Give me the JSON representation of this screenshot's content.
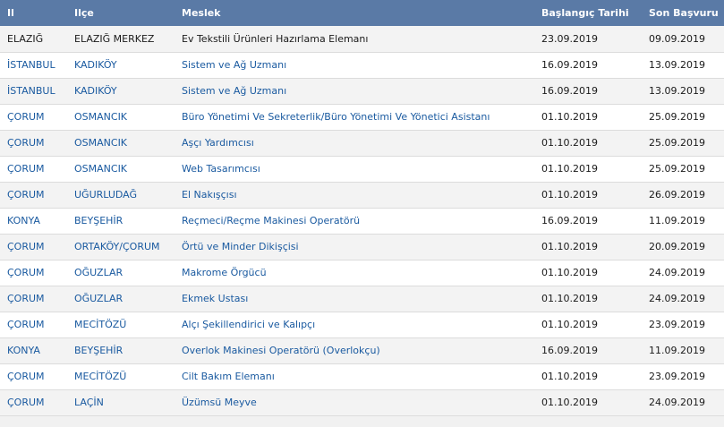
{
  "headers": {
    "il": "Il",
    "ilce": "Ilçe",
    "meslek": "Meslek",
    "baslangic": "Başlangıç Tarihi",
    "son": "Son Başvuru"
  },
  "rows": [
    {
      "il": "ELAZIĞ",
      "ilce": "ELAZIĞ MERKEZ",
      "meslek": "Ev Tekstili Ürünleri Hazırlama Elemanı",
      "baslangic": "23.09.2019",
      "son": "09.09.2019"
    },
    {
      "il": "İSTANBUL",
      "ilce": "KADIKÖY",
      "meslek": "Sistem ve Ağ Uzmanı",
      "baslangic": "16.09.2019",
      "son": "13.09.2019"
    },
    {
      "il": "İSTANBUL",
      "ilce": "KADIKÖY",
      "meslek": "Sistem ve Ağ Uzmanı",
      "baslangic": "16.09.2019",
      "son": "13.09.2019"
    },
    {
      "il": "ÇORUM",
      "ilce": "OSMANCIK",
      "meslek": "Büro Yönetimi Ve Sekreterlik/Büro Yönetimi Ve Yönetici Asistanı",
      "baslangic": "01.10.2019",
      "son": "25.09.2019"
    },
    {
      "il": "ÇORUM",
      "ilce": "OSMANCIK",
      "meslek": "Aşçı Yardımcısı",
      "baslangic": "01.10.2019",
      "son": "25.09.2019"
    },
    {
      "il": "ÇORUM",
      "ilce": "OSMANCIK",
      "meslek": "Web Tasarımcısı",
      "baslangic": "01.10.2019",
      "son": "25.09.2019"
    },
    {
      "il": "ÇORUM",
      "ilce": "UĞURLUDAĞ",
      "meslek": "El Nakışçısı",
      "baslangic": "01.10.2019",
      "son": "26.09.2019"
    },
    {
      "il": "KONYA",
      "ilce": "BEYŞEHİR",
      "meslek": "Reçmeci/Reçme Makinesi Operatörü",
      "baslangic": "16.09.2019",
      "son": "11.09.2019"
    },
    {
      "il": "ÇORUM",
      "ilce": "ORTAKÖY/ÇORUM",
      "meslek": "Örtü ve Minder Dikişçisi",
      "baslangic": "01.10.2019",
      "son": "20.09.2019"
    },
    {
      "il": "ÇORUM",
      "ilce": "OĞUZLAR",
      "meslek": "Makrome Örgücü",
      "baslangic": "01.10.2019",
      "son": "24.09.2019"
    },
    {
      "il": "ÇORUM",
      "ilce": "OĞUZLAR",
      "meslek": "Ekmek Ustası",
      "baslangic": "01.10.2019",
      "son": "24.09.2019"
    },
    {
      "il": "ÇORUM",
      "ilce": "MECİTÖZÜ",
      "meslek": "Alçı Şekillendirici ve Kalıpçı",
      "baslangic": "01.10.2019",
      "son": "23.09.2019"
    },
    {
      "il": "KONYA",
      "ilce": "BEYŞEHİR",
      "meslek": "Overlok Makinesi Operatörü (Overlokçu)",
      "baslangic": "16.09.2019",
      "son": "11.09.2019"
    },
    {
      "il": "ÇORUM",
      "ilce": "MECİTÖZÜ",
      "meslek": "Cilt Bakım Elemanı",
      "baslangic": "01.10.2019",
      "son": "23.09.2019"
    },
    {
      "il": "ÇORUM",
      "ilce": "LAÇİN",
      "meslek": "Üzümsü Meyve",
      "baslangic": "01.10.2019",
      "son": "24.09.2019"
    }
  ],
  "colors": {
    "header_bg": "#5a7aa6",
    "link": "#1a5aa0",
    "row_alt": "#f3f3f3"
  }
}
